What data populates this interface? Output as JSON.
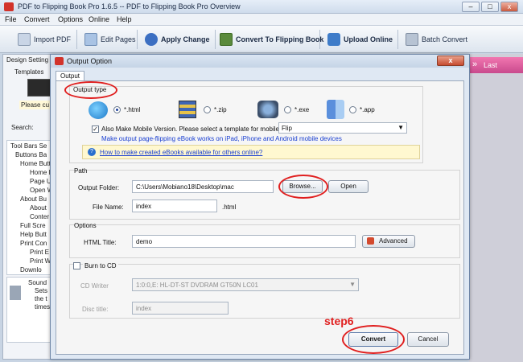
{
  "app": {
    "title": "PDF to Flipping Book Pro 1.6.5  -- PDF to Flipping Book Pro Overview",
    "menu": [
      "File",
      "Convert",
      "Options",
      "Online",
      "Help"
    ],
    "toolbar": {
      "import_pdf": "Import PDF",
      "edit_pages": "Edit Pages",
      "apply_change": "Apply Change",
      "convert": "Convert To Flipping Book",
      "upload": "Upload Online",
      "batch": "Batch Convert"
    }
  },
  "left_panel": {
    "design_settings": "Design Setting",
    "templates": "Templates",
    "please": "Please cu",
    "search_label": "Search:",
    "tree": [
      "Tool Bars Se",
      "Buttons Ba",
      "Home Butt",
      "Home B",
      "Page U",
      "Open W",
      "About Bu",
      "About",
      "Conter",
      "Full Scre",
      "Help Butt",
      "Print Con",
      "Print E",
      "Print W",
      "Downlo"
    ],
    "sound": "Sound",
    "sets": [
      "Sets",
      "the t",
      "times"
    ]
  },
  "preview": {
    "last_label": "Last"
  },
  "dialog": {
    "title": "Output Option",
    "close": "x",
    "tab": "Output",
    "output_type": {
      "label": "Output type",
      "options": [
        {
          "label": "*.html",
          "selected": true,
          "icon": "globe-icon"
        },
        {
          "label": "*.zip",
          "selected": false,
          "icon": "zip-icon"
        },
        {
          "label": "*.exe",
          "selected": false,
          "icon": "exe-icon"
        },
        {
          "label": "*.app",
          "selected": false,
          "icon": "mac-icon"
        }
      ],
      "mobile_check": "Also Make Mobile Version. Please select a template for mobile:",
      "mobile_checked": true,
      "mobile_template": "Flip",
      "mobile_note": "Make output page-flipping eBook works on iPad, iPhone and Android mobile devices",
      "help_link": "How to make created eBooks available for others online?"
    },
    "path": {
      "label": "Path",
      "folder_label": "Output Folder:",
      "folder_value": "C:\\Users\\Mobiano18\\Desktop\\mac",
      "browse": "Browse...",
      "open": "Open",
      "filename_label": "File Name:",
      "filename_value": "index",
      "ext": ".html"
    },
    "options": {
      "label": "Options",
      "html_title_label": "HTML Title:",
      "html_title_value": "demo",
      "advanced": "Advanced"
    },
    "burn": {
      "label": "Burn to CD",
      "cd_writer_label": "CD Writer",
      "cd_writer_value": "1:0:0,E: HL-DT-ST DVDRAM GT50N     LC01",
      "disc_title_label": "Disc title:",
      "disc_title_value": "index"
    },
    "annotation": "step6",
    "convert": "Convert",
    "cancel": "Cancel"
  },
  "colors": {
    "annotation_red": "#e01f1f",
    "link_blue": "#1a3fd1",
    "accent_pink": "#e0559b"
  }
}
